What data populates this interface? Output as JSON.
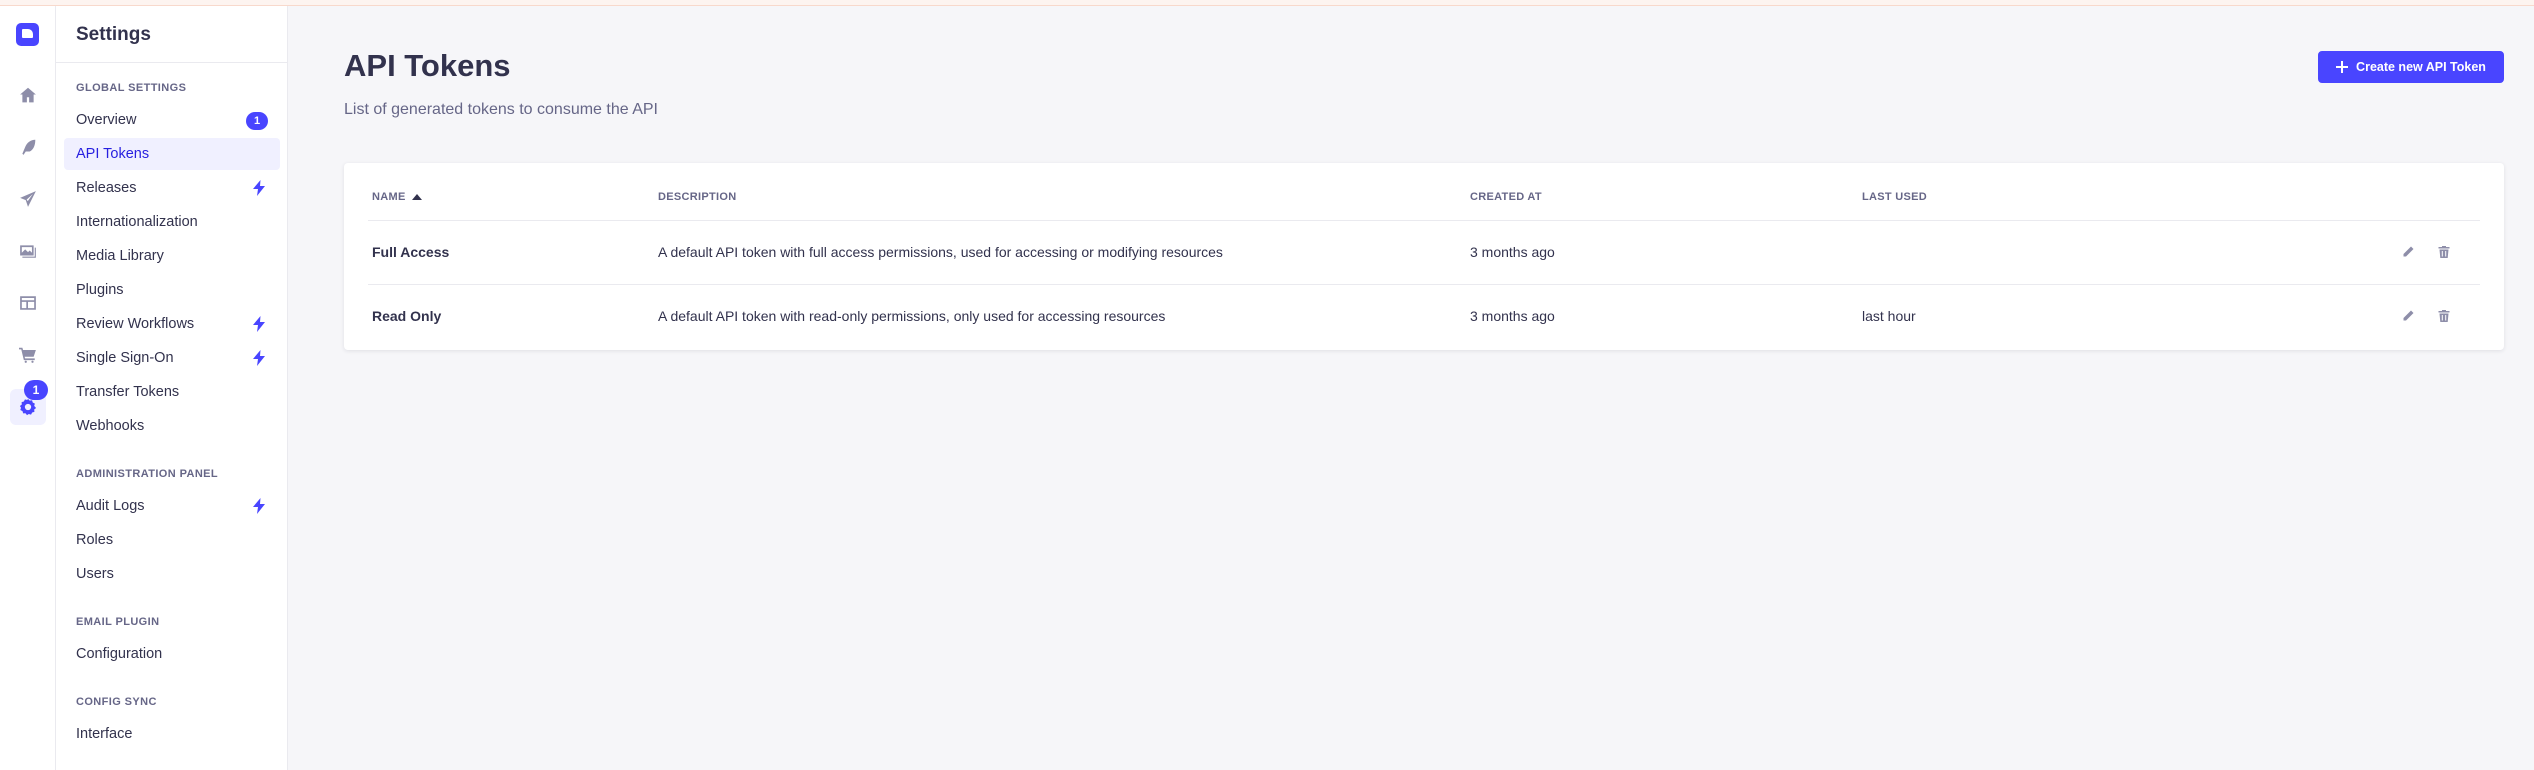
{
  "app": {
    "rail": {
      "notification_badge": "1",
      "icons": [
        "home-icon",
        "feather-icon",
        "paper-plane-icon",
        "images-icon",
        "layout-icon",
        "cart-icon",
        "gear-icon"
      ]
    },
    "accent_color": "#4945ff"
  },
  "sidebar": {
    "title": "Settings",
    "sections": [
      {
        "label": "GLOBAL SETTINGS",
        "items": [
          {
            "label": "Overview",
            "badge": "1"
          },
          {
            "label": "API Tokens",
            "active": true
          },
          {
            "label": "Releases",
            "icon": "bolt-icon"
          },
          {
            "label": "Internationalization"
          },
          {
            "label": "Media Library"
          },
          {
            "label": "Plugins"
          },
          {
            "label": "Review Workflows",
            "icon": "bolt-icon"
          },
          {
            "label": "Single Sign-On",
            "icon": "bolt-icon"
          },
          {
            "label": "Transfer Tokens"
          },
          {
            "label": "Webhooks"
          }
        ]
      },
      {
        "label": "ADMINISTRATION PANEL",
        "items": [
          {
            "label": "Audit Logs",
            "icon": "bolt-icon"
          },
          {
            "label": "Roles"
          },
          {
            "label": "Users"
          }
        ]
      },
      {
        "label": "EMAIL PLUGIN",
        "items": [
          {
            "label": "Configuration"
          }
        ]
      },
      {
        "label": "CONFIG SYNC",
        "items": [
          {
            "label": "Interface"
          }
        ]
      }
    ]
  },
  "main": {
    "title": "API Tokens",
    "subtitle": "List of generated tokens to consume the API",
    "create_button_label": "Create new API Token",
    "table": {
      "columns": [
        "NAME",
        "DESCRIPTION",
        "CREATED AT",
        "LAST USED"
      ],
      "sorted_column": "NAME",
      "sort_direction": "ascending",
      "rows": [
        {
          "name": "Full Access",
          "description": "A default API token with full access permissions, used for accessing or modifying resources",
          "created_at": "3 months ago",
          "last_used": ""
        },
        {
          "name": "Read Only",
          "description": "A default API token with read-only permissions, only used for accessing resources",
          "created_at": "3 months ago",
          "last_used": "last hour"
        }
      ]
    }
  }
}
